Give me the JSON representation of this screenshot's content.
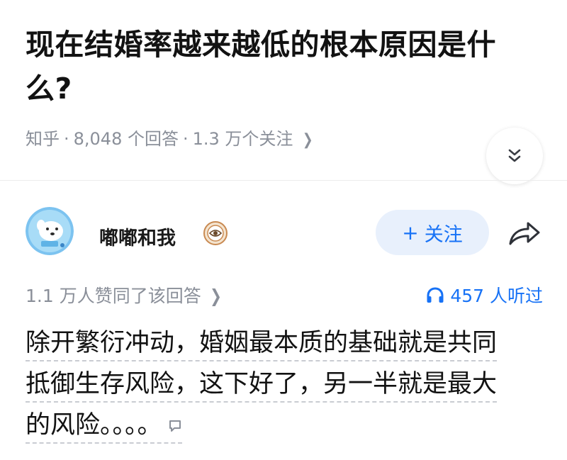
{
  "question": {
    "title": "现在结婚率越来越低的根本原因是什么?",
    "source": "知乎",
    "answers_count": "8,048 个回答",
    "followers_count": "1.3 万个关注",
    "separator": "·",
    "expand_icon": "double-chevron-down-icon",
    "meta_arrow_icon": "chevron-right-icon"
  },
  "author": {
    "name": "嘟嘟和我",
    "avatar_icon": "avatar-icon",
    "badge_icon": "eye-badge-icon",
    "follow_label": "关注",
    "follow_plus": "+",
    "share_icon": "share-arrow-icon"
  },
  "stats": {
    "votes": "1.1 万人赞同了该回答",
    "listeners": "457 人听过",
    "listen_icon": "headphones-icon"
  },
  "answer": {
    "lines": [
      "除开繁衍冲动，婚姻最本质的基础就是共同",
      "抵御生存风险，这下好了，另一半就是最大",
      "的风险。。。。"
    ],
    "comment_icon": "comment-bubble-icon"
  },
  "colors": {
    "accent": "#1772f6",
    "follow_bg": "#e8f0fc",
    "meta_gray": "#8a8f99",
    "avatar_bg": "#7cc3f0"
  }
}
